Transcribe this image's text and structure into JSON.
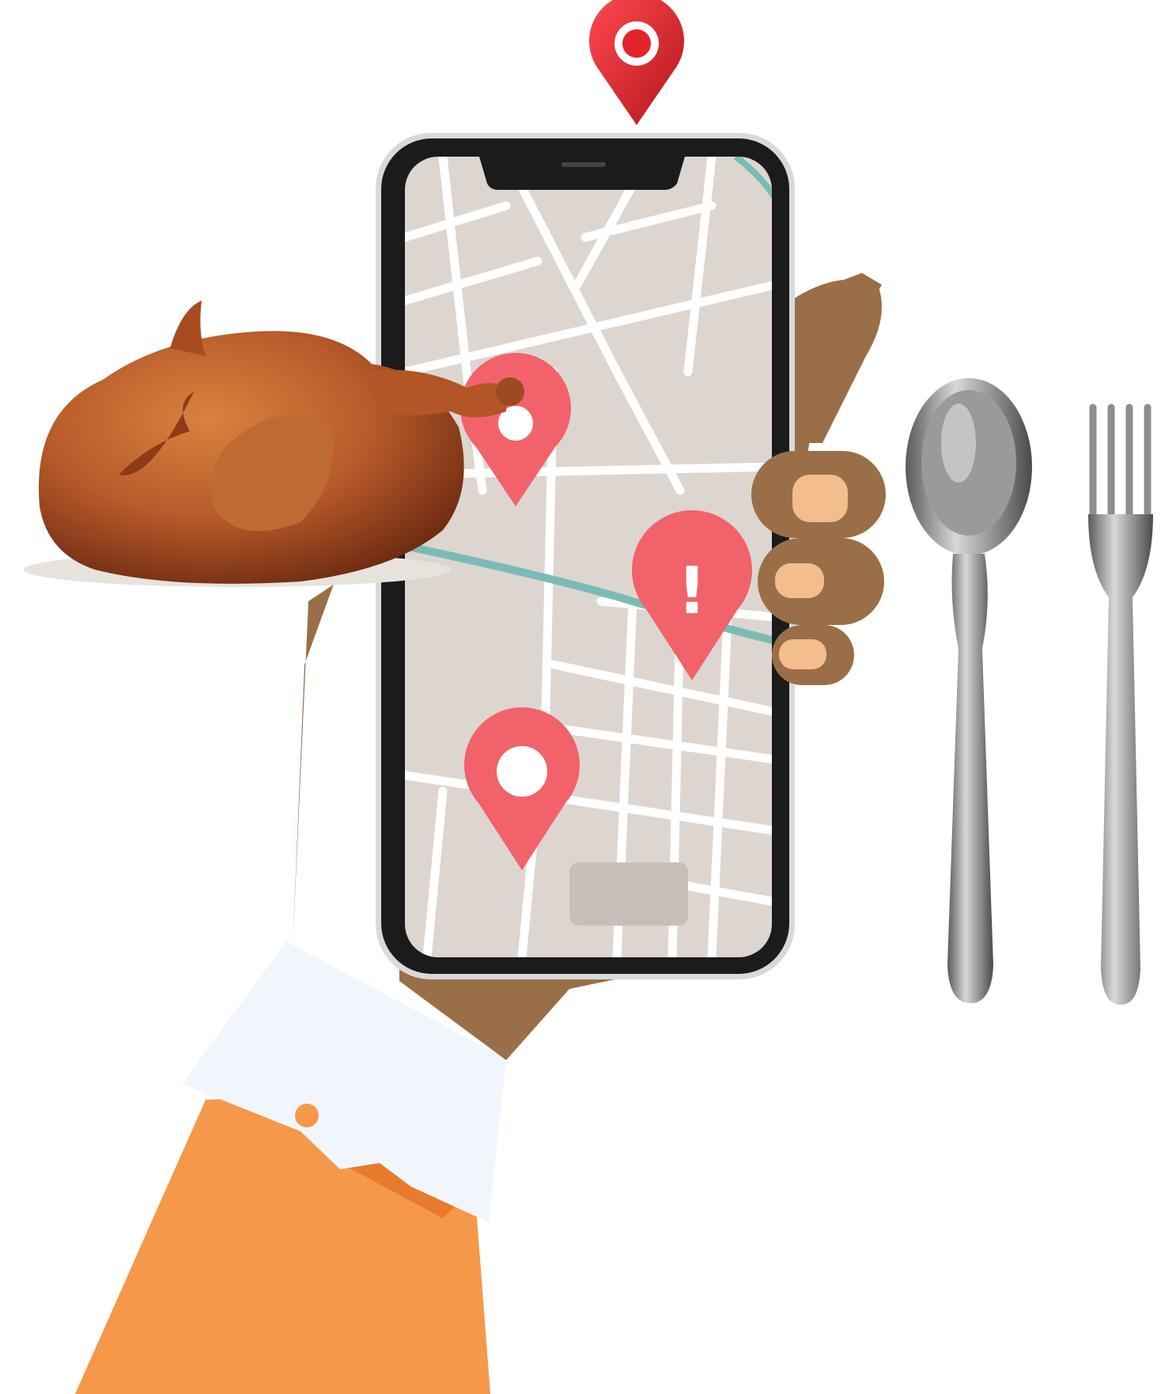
{
  "colors": {
    "background": "#ffffff",
    "pin_top_red": "#e3242b",
    "map_pin": "#f2626a",
    "map_bg": "#ddd6d0",
    "map_road": "#ffffff",
    "map_river": "#7bbbb5",
    "phone_frame": "#1b1b1b",
    "phone_bezel": "#d9d9d9",
    "skin": "#9a6f47",
    "nail": "#f3bd8e",
    "cuff": "#f1f6fc",
    "sleeve": "#f6984a",
    "sleeve_shadow": "#e87a2c",
    "chicken": "#b85a2a",
    "cutlery": "#8d8d8d"
  },
  "icons": {
    "top_pin": "location-pin-icon",
    "map_pin_1": "location-pin-icon",
    "map_pin_alert": "alert-pin-icon",
    "map_pin_3": "location-pin-icon",
    "food": "roast-chicken-icon",
    "spoon": "spoon-icon",
    "fork": "fork-icon"
  },
  "map": {
    "alert_symbol": "!"
  }
}
